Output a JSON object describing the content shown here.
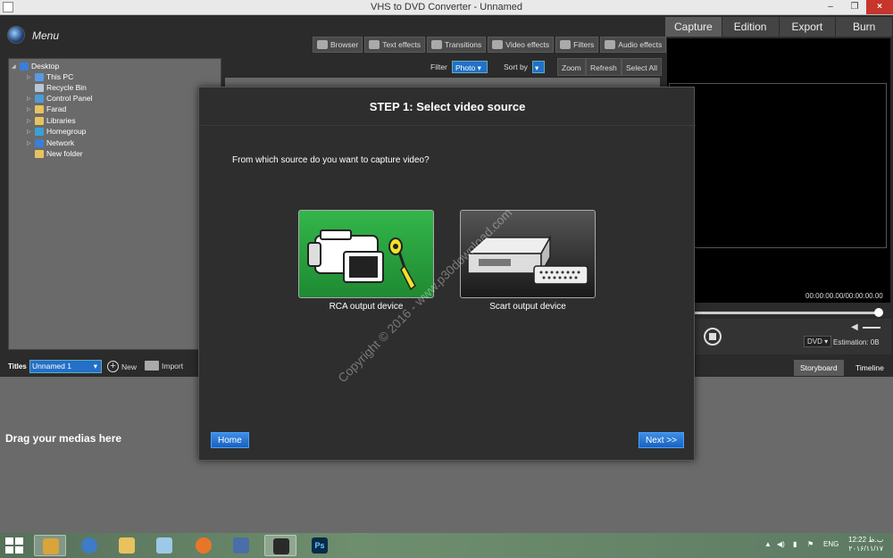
{
  "window": {
    "title": "VHS to DVD Converter - Unnamed",
    "min": "–",
    "max": "❐",
    "close": "×"
  },
  "menu": {
    "label": "Menu"
  },
  "top_tabs": [
    {
      "label": "Capture",
      "active": true
    },
    {
      "label": "Edition",
      "active": false
    },
    {
      "label": "Export",
      "active": false
    },
    {
      "label": "Burn",
      "active": false
    }
  ],
  "effects": [
    "Browser",
    "Text effects",
    "Transitions",
    "Video effects",
    "Filters",
    "Audio effects"
  ],
  "tree": [
    {
      "label": "Desktop",
      "color": "#3a7fd8"
    },
    {
      "label": "This PC",
      "color": "#5b9ae0"
    },
    {
      "label": "Recycle Bin",
      "color": "#b8c7d8"
    },
    {
      "label": "Control Panel",
      "color": "#4c9bd4"
    },
    {
      "label": "Farad",
      "color": "#e8c25e"
    },
    {
      "label": "Libraries",
      "color": "#e8c25e"
    },
    {
      "label": "Homegroup",
      "color": "#3aa0d8"
    },
    {
      "label": "Network",
      "color": "#3a7fd8"
    },
    {
      "label": "New folder",
      "color": "#e8c25e"
    }
  ],
  "filter_bar": {
    "filter_label": "Filter",
    "filter_value": "Photo",
    "sort_label": "Sort by",
    "zoom": "Zoom",
    "refresh": "Refresh",
    "select_all": "Select All"
  },
  "player": {
    "timecode": "00:00:00.00/00:00:00.00",
    "format": "DVD",
    "estimation": "Estimation: 0B"
  },
  "titles_bar": {
    "label": "Titles",
    "select_value": "Unnamed 1",
    "new": "New",
    "import": "Import"
  },
  "bottom_tabs": {
    "storyboard": "Storyboard",
    "timeline": "Timeline"
  },
  "storyboard": {
    "placeholder": "Drag your medias here"
  },
  "modal": {
    "title": "STEP 1: Select video source",
    "question": "From which source do you want to capture video?",
    "sources": [
      {
        "label": "RCA output device"
      },
      {
        "label": "Scart output device"
      }
    ],
    "home": "Home",
    "next": "Next >>"
  },
  "watermark": "Copyright © 2016 - www.p30download.com",
  "taskbar": {
    "lang": "ENG",
    "time": "12:22 ب.ظ",
    "date": "۲۰۱۶/۱۱/۱۷"
  }
}
